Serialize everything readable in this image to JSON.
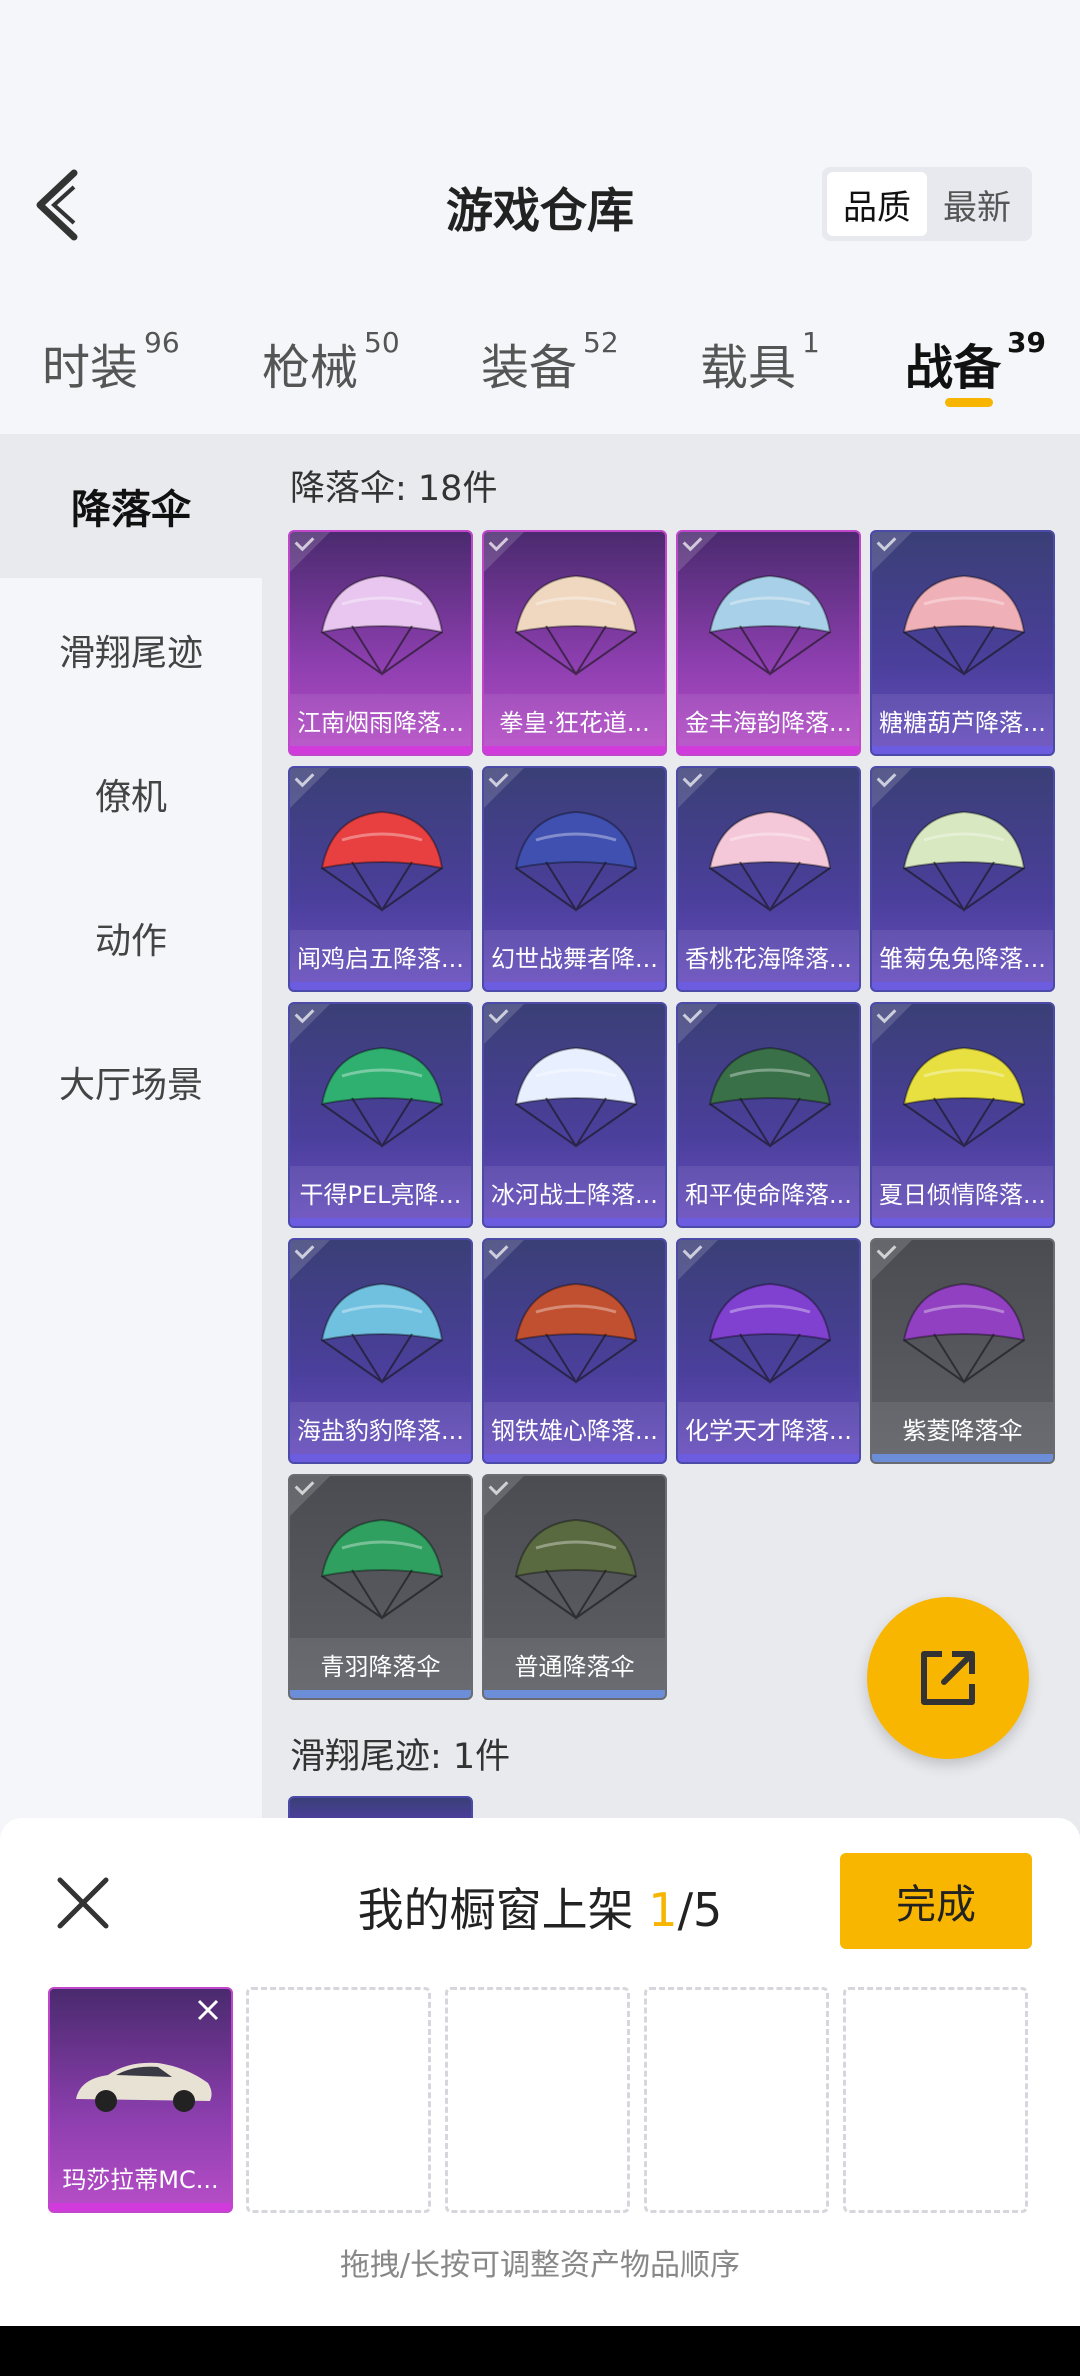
{
  "header": {
    "title": "游戏仓库",
    "sort_quality": "品质",
    "sort_newest": "最新"
  },
  "tabs": [
    {
      "label": "时装",
      "count": "96"
    },
    {
      "label": "枪械",
      "count": "50"
    },
    {
      "label": "装备",
      "count": "52"
    },
    {
      "label": "载具",
      "count": "1"
    },
    {
      "label": "战备",
      "count": "39"
    }
  ],
  "sidebar": {
    "items": [
      {
        "label": "降落伞"
      },
      {
        "label": "滑翔尾迹"
      },
      {
        "label": "僚机"
      },
      {
        "label": "动作"
      },
      {
        "label": "大厅场景"
      }
    ]
  },
  "sections": {
    "parachute_title": "降落伞: 18件",
    "trail_title": "滑翔尾迹: 1件"
  },
  "items": [
    {
      "name": "江南烟雨降落...",
      "rarity": "legend",
      "color": "#e8c6f0"
    },
    {
      "name": "拳皇·狂花道...",
      "rarity": "legend",
      "color": "#f0d8c0"
    },
    {
      "name": "金丰海韵降落...",
      "rarity": "legend",
      "color": "#a8d0e8"
    },
    {
      "name": "糖糖葫芦降落...",
      "rarity": "epic",
      "color": "#f0b0b8"
    },
    {
      "name": "闻鸡启五降落...",
      "rarity": "epic",
      "color": "#e84040"
    },
    {
      "name": "幻世战舞者降...",
      "rarity": "epic",
      "color": "#4050b0"
    },
    {
      "name": "香桃花海降落...",
      "rarity": "epic",
      "color": "#f4c8d8"
    },
    {
      "name": "雏菊兔兔降落...",
      "rarity": "epic",
      "color": "#d8e8c0"
    },
    {
      "name": "干得PEL亮降...",
      "rarity": "epic",
      "color": "#30b070"
    },
    {
      "name": "冰河战士降落...",
      "rarity": "epic",
      "color": "#e8f0ff"
    },
    {
      "name": "和平使命降落...",
      "rarity": "epic",
      "color": "#3a7048"
    },
    {
      "name": "夏日倾情降落...",
      "rarity": "epic",
      "color": "#e8e040"
    },
    {
      "name": "海盐豹豹降落...",
      "rarity": "epic",
      "color": "#70c0e0"
    },
    {
      "name": "钢铁雄心降落...",
      "rarity": "epic",
      "color": "#c05030"
    },
    {
      "name": "化学天才降落...",
      "rarity": "epic",
      "color": "#8040d0"
    },
    {
      "name": "紫菱降落伞",
      "rarity": "grey",
      "color": "#9040c0"
    },
    {
      "name": "青羽降落伞",
      "rarity": "grey",
      "color": "#30a060"
    },
    {
      "name": "普通降落伞",
      "rarity": "grey",
      "color": "#5a6a40"
    }
  ],
  "panel": {
    "title": "我的橱窗上架 ",
    "current": "1",
    "total": "/5",
    "done_label": "完成",
    "slot_item": "玛莎拉蒂MC...",
    "hint": "拖拽/长按可调整资产物品顺序"
  }
}
